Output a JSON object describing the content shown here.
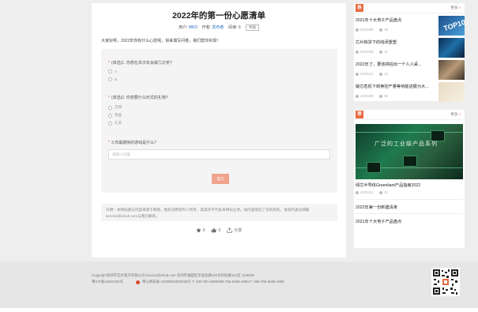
{
  "article": {
    "title": "2022年的第一份心愿清单",
    "meta": {
      "user_label": "用户:",
      "user": "MKD",
      "author_label": "作者:",
      "author": "发布者",
      "views_label": "阅读:",
      "views": "0",
      "report_label": "举报"
    },
    "intro": "大家好呀，2022年你有什么心愿呢，快来填写问卷，我们帮你实现！",
    "questions": [
      {
        "label": "(单选)1. 你想在本次年会做几次奖?",
        "options": [
          "A",
          "B"
        ]
      },
      {
        "label": "(单选)2. 你想要什么形式的礼物?",
        "options": [
          "实物",
          "现金",
          "礼券"
        ]
      },
      {
        "label": "3.你最期待的游戏是什么?",
        "placeholder": "请输入内容"
      }
    ],
    "submit_label": "提交",
    "disclaimer": "声明：本网站部分内容来源于网络，版权归原权利人所有，其观点不代表本网站立场。如内容侵犯了您的权利，请及时通过邮箱service@ichub.com与我们联系。",
    "actions": {
      "likes": "0",
      "thumbs": "0",
      "share_label": "分享"
    }
  },
  "sidebar": {
    "hot": {
      "tag": "热",
      "more_label": "更多",
      "items": [
        {
          "title": "2021年十大电子产品盘点",
          "date": "22/01/09",
          "views": "46"
        },
        {
          "title": "芯片缺货下的线闭重塑",
          "date": "22/01/09",
          "views": "31"
        },
        {
          "title": "2022年了，要该拼拍出一个人人桌...",
          "date": "22/01/12",
          "views": "32"
        },
        {
          "title": "疑芯危机下转换控产量等待能进展为大...",
          "date": "22/01/09",
          "views": "56"
        }
      ]
    },
    "recommend": {
      "tag": "荐",
      "more_label": "更多",
      "banner_caption": "广泛的工业级产品系列",
      "feature": {
        "title": "绿芯半导体Greenliant产品指南2022",
        "date": "22/01/14",
        "views": "12"
      },
      "links": [
        "2022年第一份新建清单",
        "2021年十大电子产品盘点"
      ]
    }
  },
  "footer": {
    "line1": "Copyright深圳市芯片电子有限公司    service@ichub.com    深圳市福田区华强北路100号科技楼101室, 518048",
    "icp": "粤ICP备16032300号",
    "police": "粤公网安备 44030502000035号 T: 400-780-2888/086-755-8288-2888    F: 086-755-8288-2999"
  },
  "colors": {
    "accent": "#e8693f",
    "link": "#2e6fc4",
    "submit": "#f0a38c"
  }
}
